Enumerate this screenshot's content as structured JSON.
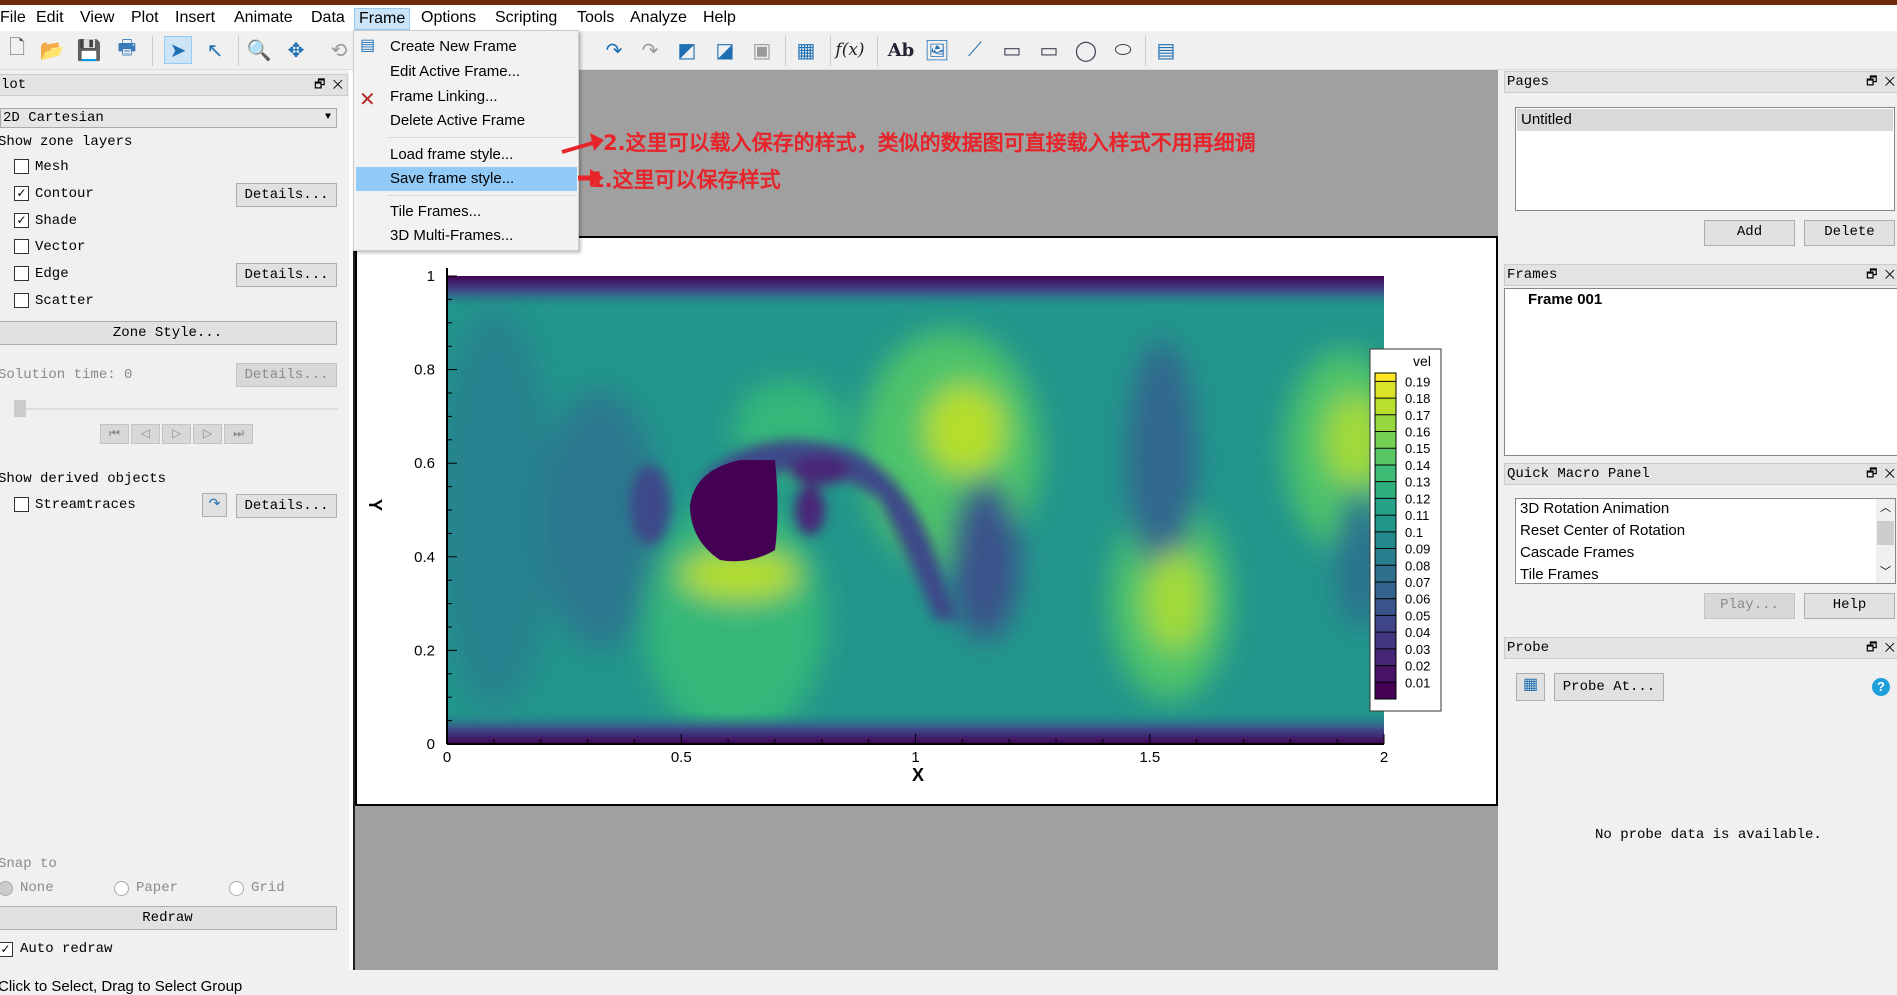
{
  "menubar": {
    "items": [
      "File",
      "Edit",
      "View",
      "Plot",
      "Insert",
      "Animate",
      "Data",
      "Frame",
      "Options",
      "Scripting",
      "Tools",
      "Analyze",
      "Help"
    ],
    "active": "Frame"
  },
  "toolbar": {
    "icons": [
      "new-file-icon",
      "open-file-icon",
      "save-icon",
      "print-icon",
      "select-arrow-icon",
      "adjustor-arrow-icon",
      "zoom-icon",
      "translate-icon",
      "rotate-icon",
      "streamtrace-icon",
      "streamtrace-rake-icon",
      "add-contour-icon",
      "remove-contour-icon",
      "slice-icon",
      "probe-icon",
      "equation-icon",
      "text-icon",
      "image-icon",
      "polyline-icon",
      "square-icon",
      "rectangle-icon",
      "circle-icon",
      "ellipse-icon",
      "frame-icon"
    ],
    "fx": "f(x)",
    "text_tool": "Ab"
  },
  "frame_menu": {
    "items": [
      {
        "label": "Create New Frame",
        "icon": "new-frame-icon"
      },
      {
        "label": "Edit Active Frame..."
      },
      {
        "label": "Frame Linking..."
      },
      {
        "label": "Delete Active Frame",
        "icon": "delete-x-icon"
      },
      {
        "label": "Load frame style..."
      },
      {
        "label": "Save frame style...",
        "highlighted": true
      },
      {
        "label": "Tile Frames..."
      },
      {
        "label": "3D Multi-Frames..."
      }
    ]
  },
  "annotations": {
    "note2": "2.这里可以载入保存的样式，类似的数据图可直接载入样式不用再细调",
    "note1": "1.这里可以保存样式",
    "color": "#e8242b"
  },
  "left_panel": {
    "title": "lot",
    "plot_type": "2D Cartesian",
    "show_zone_layers": "Show zone layers",
    "layers": [
      {
        "label": "Mesh",
        "checked": false
      },
      {
        "label": "Contour",
        "checked": true,
        "details": "Details..."
      },
      {
        "label": "Shade",
        "checked": true
      },
      {
        "label": "Vector",
        "checked": false
      },
      {
        "label": "Edge",
        "checked": false,
        "details": "Details..."
      },
      {
        "label": "Scatter",
        "checked": false
      }
    ],
    "zone_style": "Zone Style...",
    "solution_time": "Solution time: 0",
    "solution_details": "Details...",
    "show_derived": "Show derived objects",
    "streamtraces": {
      "label": "Streamtraces",
      "checked": false,
      "details": "Details..."
    },
    "snap_to": "Snap to",
    "snap_options": [
      {
        "label": "None",
        "selected": true
      },
      {
        "label": "Paper",
        "selected": false
      },
      {
        "label": "Grid",
        "selected": false
      }
    ],
    "redraw": "Redraw",
    "auto_redraw": {
      "label": "Auto redraw",
      "checked": true
    }
  },
  "status_bar": "Click to Select, Drag to Select Group",
  "right_panel": {
    "pages": {
      "title": "Pages",
      "items": [
        "Untitled"
      ],
      "add": "Add",
      "delete": "Delete"
    },
    "frames": {
      "title": "Frames",
      "items": [
        "Frame 001"
      ]
    },
    "macros": {
      "title": "Quick Macro Panel",
      "items": [
        "3D Rotation Animation",
        "Reset Center of Rotation",
        "Cascade Frames",
        "Tile Frames"
      ],
      "play": "Play...",
      "help": "Help"
    },
    "probe": {
      "title": "Probe",
      "probe_at": "Probe At...",
      "empty": "No probe data is available."
    }
  },
  "chart_data": {
    "type": "heatmap",
    "subtype": "contour flooded",
    "xlabel": "X",
    "ylabel": "Y",
    "xlim": [
      0,
      2
    ],
    "ylim": [
      0,
      1
    ],
    "xticks": [
      "0",
      "0.5",
      "1",
      "1.5",
      "2"
    ],
    "yticks": [
      "0",
      "0.2",
      "0.4",
      "0.6",
      "0.8",
      "1"
    ],
    "legend": {
      "title": "vel",
      "position": "right",
      "levels": [
        "0.19",
        "0.18",
        "0.17",
        "0.16",
        "0.15",
        "0.14",
        "0.13",
        "0.12",
        "0.11",
        "0.1",
        "0.09",
        "0.08",
        "0.07",
        "0.06",
        "0.05",
        "0.04",
        "0.03",
        "0.02",
        "0.01"
      ]
    },
    "colormap": [
      "#440154",
      "#482878",
      "#3e4989",
      "#31688e",
      "#26828e",
      "#1f9e89",
      "#35b779",
      "#6ece58",
      "#b5de2b",
      "#fde725"
    ]
  }
}
